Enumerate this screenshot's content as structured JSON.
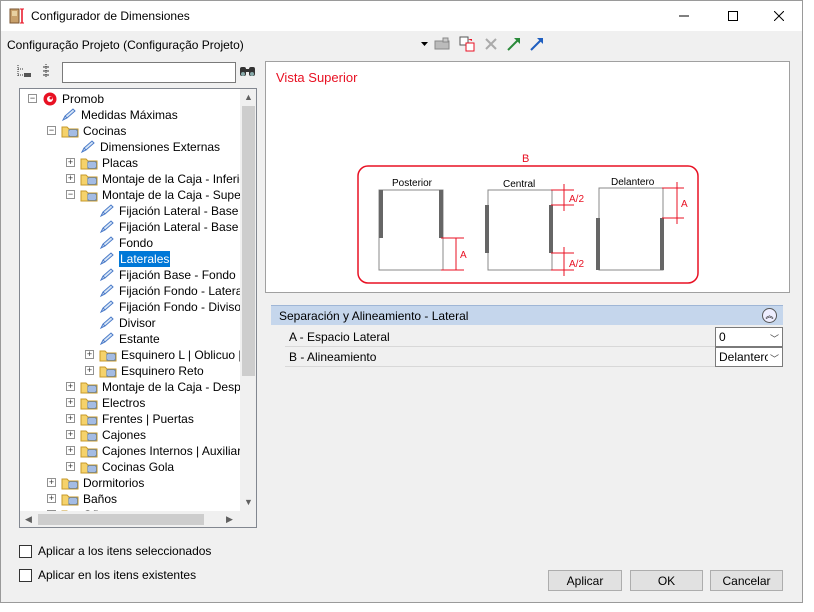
{
  "window": {
    "title": "Configurador de Dimensiones",
    "minimize_icon": "minimize-icon",
    "maximize_icon": "maximize-icon",
    "close_icon": "close-icon"
  },
  "toolbar": {
    "config_label": "Configuração Projeto (Configuração Projeto)"
  },
  "tree": {
    "search_value": "",
    "rows": [
      {
        "label": "Promob",
        "level": 0,
        "icon": "promob-logo",
        "expander": "−"
      },
      {
        "label": "Medidas Máximas",
        "level": 1,
        "icon": "pencil-icon",
        "expander": ""
      },
      {
        "label": "Cocinas",
        "level": 1,
        "icon": "folder-icon",
        "expander": "−"
      },
      {
        "label": "Dimensiones Externas",
        "level": 2,
        "icon": "pencil-icon",
        "expander": ""
      },
      {
        "label": "Placas",
        "level": 2,
        "icon": "folder-icon",
        "expander": "+"
      },
      {
        "label": "Montaje de la Caja - Inferior",
        "level": 2,
        "icon": "folder-icon",
        "expander": "+"
      },
      {
        "label": "Montaje de la Caja - Superior",
        "level": 2,
        "icon": "folder-icon",
        "expander": "−"
      },
      {
        "label": "Fijación Lateral - Base Inf",
        "level": 3,
        "icon": "pencil-icon",
        "expander": ""
      },
      {
        "label": "Fijación Lateral - Base Su",
        "level": 3,
        "icon": "pencil-icon",
        "expander": ""
      },
      {
        "label": "Fondo",
        "level": 3,
        "icon": "pencil-icon",
        "expander": ""
      },
      {
        "label": "Laterales",
        "level": 3,
        "icon": "pencil-icon",
        "expander": "",
        "selected": true
      },
      {
        "label": " Fijación Base - Fondo",
        "level": 3,
        "icon": "pencil-icon",
        "expander": ""
      },
      {
        "label": "Fijación Fondo - Lateral",
        "level": 3,
        "icon": "pencil-icon",
        "expander": ""
      },
      {
        "label": "Fijación Fondo - Divisoria",
        "level": 3,
        "icon": "pencil-icon",
        "expander": ""
      },
      {
        "label": "Divisor",
        "level": 3,
        "icon": "pencil-icon",
        "expander": ""
      },
      {
        "label": "Estante",
        "level": 3,
        "icon": "pencil-icon",
        "expander": ""
      },
      {
        "label": "Esquinero L | Oblicuo | Cu",
        "level": 3,
        "icon": "folder-icon",
        "expander": "+"
      },
      {
        "label": "Esquinero Reto",
        "level": 3,
        "icon": "folder-icon",
        "expander": "+"
      },
      {
        "label": "Montaje de la Caja - Despens",
        "level": 2,
        "icon": "folder-icon",
        "expander": "+"
      },
      {
        "label": "Electros",
        "level": 2,
        "icon": "folder-icon",
        "expander": "+"
      },
      {
        "label": "Frentes | Puertas",
        "level": 2,
        "icon": "folder-icon",
        "expander": "+"
      },
      {
        "label": "Cajones",
        "level": 2,
        "icon": "folder-icon",
        "expander": "+"
      },
      {
        "label": "Cajones Internos | Auxiliares",
        "level": 2,
        "icon": "folder-icon",
        "expander": "+"
      },
      {
        "label": "Cocinas Gola",
        "level": 2,
        "icon": "folder-icon",
        "expander": "+"
      },
      {
        "label": "Dormitorios",
        "level": 1,
        "icon": "folder-icon",
        "expander": "+"
      },
      {
        "label": "Baños",
        "level": 1,
        "icon": "folder-icon",
        "expander": "+"
      },
      {
        "label": "Ofic...",
        "level": 1,
        "icon": "folder-icon",
        "expander": "+"
      }
    ]
  },
  "preview": {
    "title": "Vista Superior",
    "label_b": "B",
    "label_posterior": "Posterior",
    "label_central": "Central",
    "label_delantero": "Delantero",
    "label_a": "A",
    "label_a2": "A/2"
  },
  "properties": {
    "header": "Separación y Alineamiento -  Lateral",
    "rows": [
      {
        "label": "A - Espacio Lateral",
        "value": "0"
      },
      {
        "label": "B - Alineamiento",
        "value": "Delantero"
      }
    ]
  },
  "options": {
    "apply_selected": "Aplicar a los itens seleccionados",
    "apply_existing": "Aplicar en los itens existentes"
  },
  "buttons": {
    "apply": "Aplicar",
    "ok": "OK",
    "cancel": "Cancelar"
  },
  "colors": {
    "accent_red": "#e81123",
    "selection_blue": "#0078d7",
    "header_blue": "#c5d6ec"
  }
}
